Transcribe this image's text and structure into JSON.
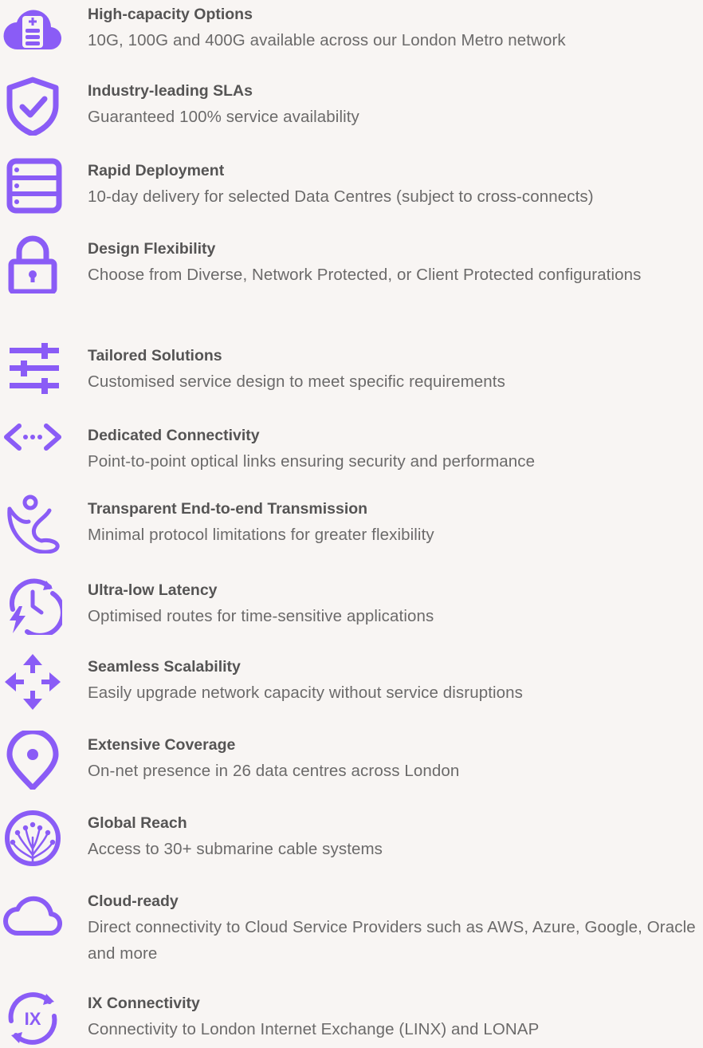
{
  "accent_color": "#8a5cf6",
  "features": [
    {
      "icon": "cloud-database-icon",
      "title": "High-capacity Options",
      "desc": "10G, 100G and 400G available across our London Metro network"
    },
    {
      "icon": "shield-check-icon",
      "title": "Industry-leading SLAs",
      "desc": "Guaranteed 100% service availability"
    },
    {
      "icon": "server-stack-icon",
      "title": "Rapid Deployment",
      "desc": "10-day delivery for selected Data Centres (subject to cross-connects)"
    },
    {
      "icon": "padlock-icon",
      "title": "Design Flexibility",
      "desc": "Choose from Diverse, Network Protected, or Client Protected configurations"
    },
    {
      "icon": "sliders-icon",
      "title": "Tailored Solutions",
      "desc": "Customised service design to meet specific requirements"
    },
    {
      "icon": "code-arrows-icon",
      "title": "Dedicated Connectivity",
      "desc": "Point-to-point optical links ensuring security and performance"
    },
    {
      "icon": "flexible-person-icon",
      "title": "Transparent End-to-end Transmission",
      "desc": "Minimal protocol limitations for greater flexibility"
    },
    {
      "icon": "clock-lightning-icon",
      "title": "Ultra-low Latency",
      "desc": "Optimised routes for time-sensitive applications"
    },
    {
      "icon": "expand-arrows-icon",
      "title": "Seamless Scalability",
      "desc": "Easily upgrade network capacity without service disruptions"
    },
    {
      "icon": "map-pin-icon",
      "title": "Extensive Coverage",
      "desc": "On-net presence in 26 data centres across London"
    },
    {
      "icon": "fiber-globe-icon",
      "title": "Global Reach",
      "desc": "Access to 30+ submarine cable systems"
    },
    {
      "icon": "cloud-icon",
      "title": "Cloud-ready",
      "desc": "Direct connectivity to Cloud Service Providers such as AWS, Azure, Google, Oracle and more"
    },
    {
      "icon": "ix-exchange-icon",
      "title": "IX Connectivity",
      "desc": "Connectivity to London Internet Exchange (LINX) and LONAP"
    }
  ]
}
